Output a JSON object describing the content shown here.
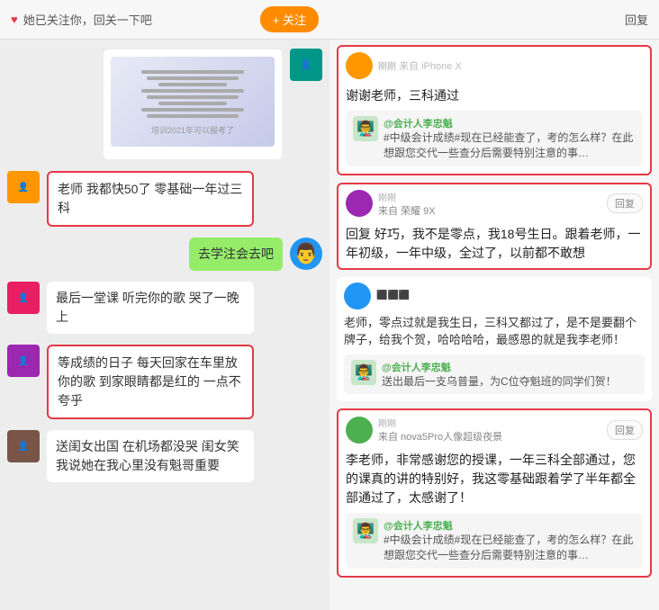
{
  "left": {
    "header": {
      "notification": "她已关注你，回关一下吧",
      "follow_btn": "+ 关注"
    },
    "messages": [
      {
        "id": "msg-doc",
        "type": "doc",
        "side": "right",
        "avatar_color": "av-teal"
      },
      {
        "id": "msg-1",
        "type": "text",
        "side": "left",
        "text": "老师 我都快50了 零基础一年过三科",
        "highlighted": true,
        "avatar_color": "av-orange"
      },
      {
        "id": "msg-2",
        "type": "text",
        "side": "right",
        "text": "去学注会去吧",
        "highlighted": false,
        "avatar_color": "av-blue"
      },
      {
        "id": "msg-3",
        "type": "text",
        "side": "left",
        "text": "最后一堂课 听完你的歌 哭了一晚上",
        "highlighted": false,
        "avatar_color": "av-pink"
      },
      {
        "id": "msg-4",
        "type": "text",
        "side": "left",
        "text": "等成绩的日子 每天回家在车里放你的歌 到家眼睛都是红的 一点不夸乎",
        "highlighted": true,
        "avatar_color": "av-purple"
      },
      {
        "id": "msg-5",
        "type": "text",
        "side": "left",
        "text": "送闺女出国 在机场都没哭 闺女笑我说她在我心里没有魁哥重要",
        "highlighted": false,
        "avatar_color": "av-brown"
      }
    ]
  },
  "right": {
    "header": {
      "reply_btn": "回复"
    },
    "comments": [
      {
        "id": "c1",
        "username": "来自 iPhone X",
        "device": "",
        "main_text": "谢谢老师，三科通过",
        "highlighted": true,
        "show_reply_btn": false,
        "nested": {
          "username": "@会计人李忠魁",
          "text": "#中级会计成绩#现在已经能查了，考的怎么样？在此想跟您交代一些查分后需要特别注意的事…"
        }
      },
      {
        "id": "c2",
        "username": "来自 荣耀 9X",
        "device": "",
        "main_text": "回复        好巧，我不是零点，我18号生日。跟着老师，一年初级，一年中级，全过了，以前都不敢想",
        "highlighted": true,
        "show_reply_btn": true,
        "nested": null
      },
      {
        "id": "c3",
        "username": "",
        "device": "",
        "main_text": "老师，零点过就是我生日，三科又都过了，是不是要翻个牌子，给我个贺，哈哈哈哈，最感恩的就是我李老师！",
        "highlighted": false,
        "show_reply_btn": false,
        "nested": {
          "username": "@会计人李忠魁",
          "text": "送出最后一支乌普量，为C位夺魁班的同学们贺！"
        }
      },
      {
        "id": "c4",
        "username": "来自 nova5Pro人像超级夜景",
        "device": "",
        "main_text": "李老师，非常感谢您的授课，一年三科全部通过，您的课真的讲的特别好，我这零基础跟着学了半年都全部通过了，太感谢了！",
        "highlighted": true,
        "show_reply_btn": true,
        "nested": {
          "username": "@会计人李忠魁",
          "text": "#中级会计成绩#现在已经能查了，考的怎么样？在此想跟您交代一些查分后需要特别注意的事…"
        }
      }
    ]
  }
}
